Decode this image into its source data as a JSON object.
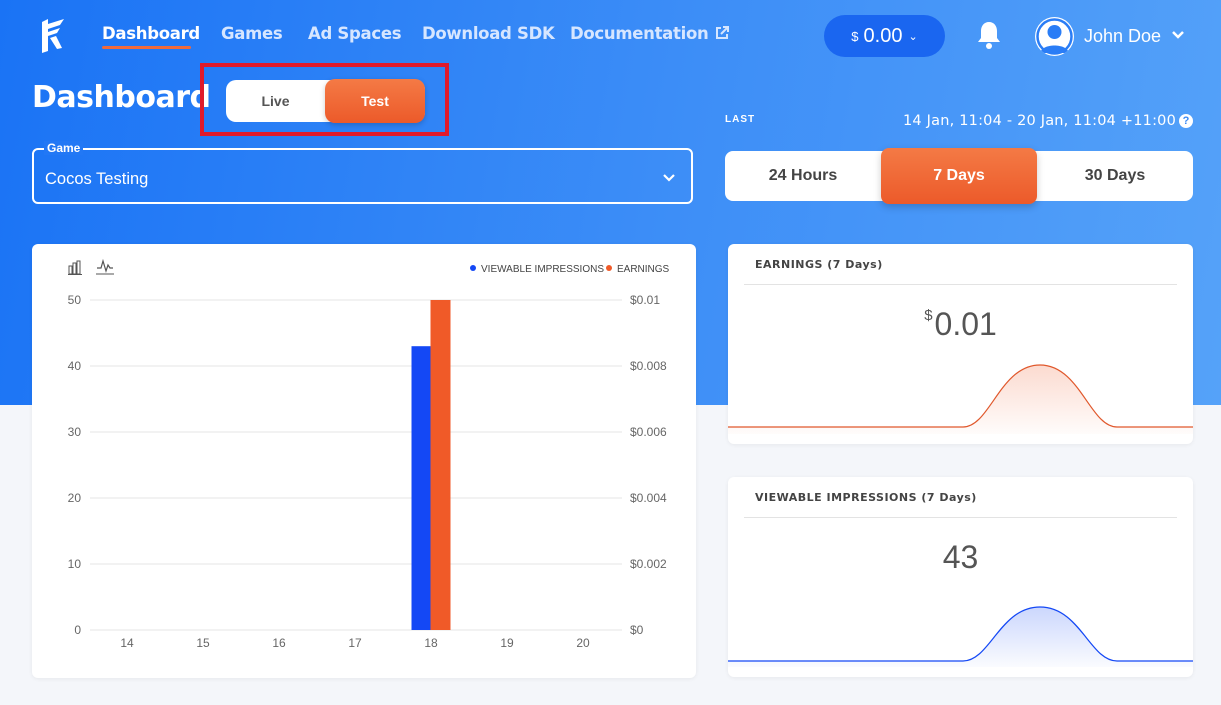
{
  "nav": {
    "items": [
      {
        "label": "Dashboard",
        "active": true
      },
      {
        "label": "Games",
        "active": false
      },
      {
        "label": "Ad Spaces",
        "active": false
      },
      {
        "label": "Download SDK",
        "active": false
      },
      {
        "label": "Documentation",
        "active": false
      }
    ],
    "balance": {
      "currency": "$",
      "amount": "0.00"
    },
    "user": {
      "name": "John Doe"
    }
  },
  "page": {
    "title": "Dashboard"
  },
  "mode_toggle": {
    "options": [
      "Live",
      "Test"
    ],
    "selected": "Test"
  },
  "game_select": {
    "label": "Game",
    "value": "Cocos Testing"
  },
  "date_filter": {
    "last_label": "LAST",
    "range_text": "14 Jan, 11:04 - 20 Jan, 11:04 +11:00",
    "help_icon": "question-circle-icon",
    "tabs": [
      "24 Hours",
      "7 Days",
      "30 Days"
    ],
    "selected": "7 Days"
  },
  "colors": {
    "accent": "#f06a3b",
    "primary": "#1a73f5",
    "impressions": "#1448f5",
    "earnings": "#f05a28"
  },
  "chart_data": {
    "type": "bar",
    "categories": [
      "14",
      "15",
      "16",
      "17",
      "18",
      "19",
      "20"
    ],
    "series": [
      {
        "name": "VIEWABLE IMPRESSIONS",
        "axis": "left",
        "values": [
          0,
          0,
          0,
          0,
          43,
          0,
          0
        ]
      },
      {
        "name": "EARNINGS",
        "axis": "right",
        "values": [
          0,
          0,
          0,
          0,
          0.01,
          0,
          0
        ]
      }
    ],
    "y_left": {
      "ticks": [
        "0",
        "10",
        "20",
        "30",
        "40",
        "50"
      ],
      "ylim": [
        0,
        50
      ]
    },
    "y_right": {
      "ticks": [
        "$0",
        "$0.002",
        "$0.004",
        "$0.006",
        "$0.008",
        "$0.01"
      ],
      "ylim": [
        0,
        0.01
      ]
    },
    "legend_position": "top-right",
    "grid": true,
    "toolbar_icons": [
      "bar-chart-icon",
      "line-chart-icon"
    ]
  },
  "stats": {
    "earnings": {
      "title": "EARNINGS (7 Days)",
      "currency": "$",
      "value": "0.01"
    },
    "impressions": {
      "title": "VIEWABLE IMPRESSIONS (7 Days)",
      "value": "43"
    }
  }
}
